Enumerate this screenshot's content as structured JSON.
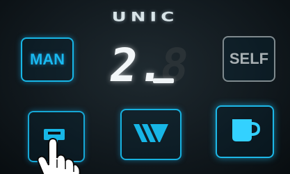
{
  "brand": {
    "name": "UNIC"
  },
  "buttons": {
    "man_label": "MAN",
    "self_label": "SELF"
  },
  "display": {
    "value_main": "2.",
    "value_dim": "8"
  },
  "icons": {
    "small_cup": "cup-icon",
    "w_symbol": "w-icon",
    "large_cup": "mug-icon",
    "hand": "hand-pointer-icon"
  },
  "colors": {
    "accent": "#17b6e6",
    "inactive": "#7f8a8e",
    "display": "#f2f6f8",
    "background": "#121a1f"
  }
}
